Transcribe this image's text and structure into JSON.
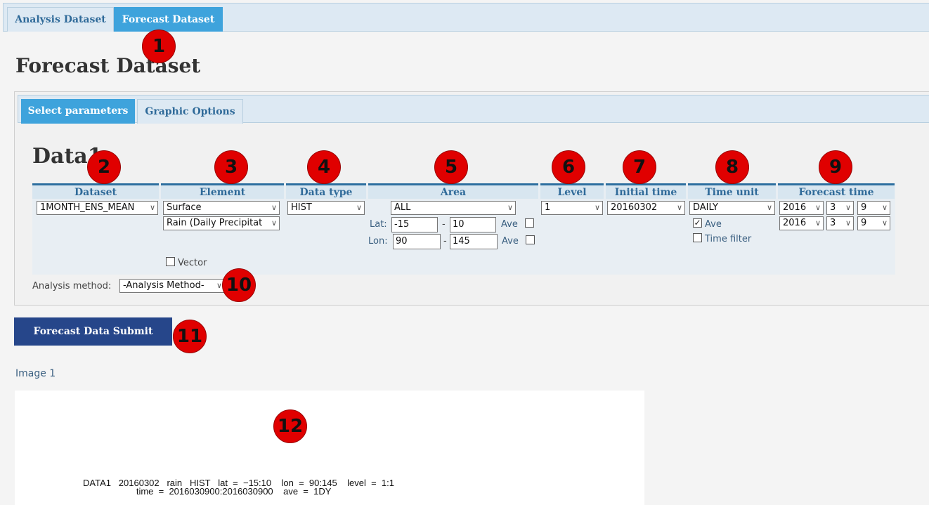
{
  "tabs": {
    "analysis": "Analysis Dataset",
    "forecast": "Forecast Dataset"
  },
  "page_title": "Forecast Dataset",
  "inner_tabs": {
    "select_params": "Select parameters",
    "graphic_options": "Graphic Options"
  },
  "data_title": "Data1",
  "columns": {
    "dataset": "Dataset",
    "element": "Element",
    "data_type": "Data type",
    "area": "Area",
    "level": "Level",
    "initial_time": "Initial time",
    "time_unit": "Time unit",
    "forecast_time": "Forecast time"
  },
  "fields": {
    "dataset": "1MONTH_ENS_MEAN",
    "element_category": "Surface",
    "element": "Rain (Daily Precipitat",
    "vector_label": "Vector",
    "data_type": "HIST",
    "area": "ALL",
    "lat_label": "Lat:",
    "lat_from": "-15",
    "lat_to": "10",
    "lon_label": "Lon:",
    "lon_from": "90",
    "lon_to": "145",
    "dash": "-",
    "ave_label": "Ave",
    "level": "1",
    "initial_time": "20160302",
    "time_unit": "DAILY",
    "time_ave_label": "Ave",
    "time_filter_label": "Time filter",
    "forecast_start": {
      "year": "2016",
      "month": "3",
      "day": "9"
    },
    "forecast_end": {
      "year": "2016",
      "month": "3",
      "day": "9"
    }
  },
  "analysis_method": {
    "label": "Analysis method:",
    "value": "-Analysis Method-"
  },
  "submit_label": "Forecast Data Submit",
  "image_label": "Image 1",
  "plot_text": {
    "line1": "DATA1   20160302   rain   HIST   lat  =  −15:10    lon  =  90:145    level  =  1:1",
    "line2": "                     time  =  2016030900:2016030900    ave  =  1DY"
  },
  "markers": [
    "1",
    "2",
    "3",
    "4",
    "5",
    "6",
    "7",
    "8",
    "9",
    "10",
    "11",
    "12"
  ]
}
